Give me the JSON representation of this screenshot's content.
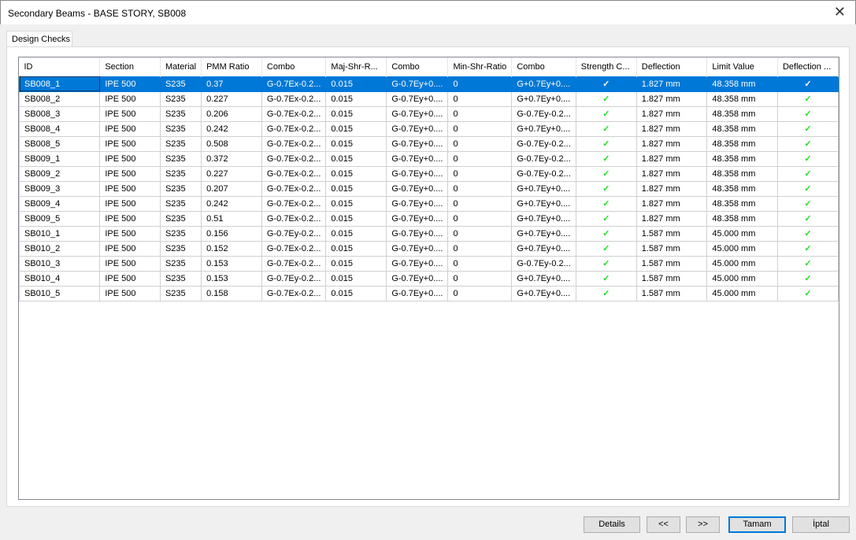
{
  "window": {
    "title": "Secondary Beams - BASE STORY, SB008",
    "close": "✕"
  },
  "tab": "Design Checks",
  "columns": [
    "ID",
    "Section",
    "Material",
    "PMM Ratio",
    "Combo",
    "Maj-Shr-R...",
    "Combo",
    "Min-Shr-Ratio",
    "Combo",
    "Strength C...",
    "Deflection",
    "Limit Value",
    "Deflection ..."
  ],
  "rows": [
    [
      "SB008_1",
      "IPE 500",
      "S235",
      "0.37",
      "G-0.7Ex-0.2...",
      "0.015",
      "G-0.7Ey+0....",
      "0",
      "G+0.7Ey+0....",
      "✓",
      "1.827 mm",
      "48.358 mm",
      "✓"
    ],
    [
      "SB008_2",
      "IPE 500",
      "S235",
      "0.227",
      "G-0.7Ex-0.2...",
      "0.015",
      "G-0.7Ey+0....",
      "0",
      "G+0.7Ey+0....",
      "✓",
      "1.827 mm",
      "48.358 mm",
      "✓"
    ],
    [
      "SB008_3",
      "IPE 500",
      "S235",
      "0.206",
      "G-0.7Ex-0.2...",
      "0.015",
      "G-0.7Ey+0....",
      "0",
      "G-0.7Ey-0.2...",
      "✓",
      "1.827 mm",
      "48.358 mm",
      "✓"
    ],
    [
      "SB008_4",
      "IPE 500",
      "S235",
      "0.242",
      "G-0.7Ex-0.2...",
      "0.015",
      "G-0.7Ey+0....",
      "0",
      "G+0.7Ey+0....",
      "✓",
      "1.827 mm",
      "48.358 mm",
      "✓"
    ],
    [
      "SB008_5",
      "IPE 500",
      "S235",
      "0.508",
      "G-0.7Ex-0.2...",
      "0.015",
      "G-0.7Ey+0....",
      "0",
      "G-0.7Ey-0.2...",
      "✓",
      "1.827 mm",
      "48.358 mm",
      "✓"
    ],
    [
      "SB009_1",
      "IPE 500",
      "S235",
      "0.372",
      "G-0.7Ex-0.2...",
      "0.015",
      "G-0.7Ey+0....",
      "0",
      "G-0.7Ey-0.2...",
      "✓",
      "1.827 mm",
      "48.358 mm",
      "✓"
    ],
    [
      "SB009_2",
      "IPE 500",
      "S235",
      "0.227",
      "G-0.7Ex-0.2...",
      "0.015",
      "G-0.7Ey+0....",
      "0",
      "G-0.7Ey-0.2...",
      "✓",
      "1.827 mm",
      "48.358 mm",
      "✓"
    ],
    [
      "SB009_3",
      "IPE 500",
      "S235",
      "0.207",
      "G-0.7Ex-0.2...",
      "0.015",
      "G-0.7Ey+0....",
      "0",
      "G+0.7Ey+0....",
      "✓",
      "1.827 mm",
      "48.358 mm",
      "✓"
    ],
    [
      "SB009_4",
      "IPE 500",
      "S235",
      "0.242",
      "G-0.7Ex-0.2...",
      "0.015",
      "G-0.7Ey+0....",
      "0",
      "G+0.7Ey+0....",
      "✓",
      "1.827 mm",
      "48.358 mm",
      "✓"
    ],
    [
      "SB009_5",
      "IPE 500",
      "S235",
      "0.51",
      "G-0.7Ex-0.2...",
      "0.015",
      "G-0.7Ey+0....",
      "0",
      "G+0.7Ey+0....",
      "✓",
      "1.827 mm",
      "48.358 mm",
      "✓"
    ],
    [
      "SB010_1",
      "IPE 500",
      "S235",
      "0.156",
      "G-0.7Ey-0.2...",
      "0.015",
      "G-0.7Ey+0....",
      "0",
      "G+0.7Ey+0....",
      "✓",
      "1.587 mm",
      "45.000 mm",
      "✓"
    ],
    [
      "SB010_2",
      "IPE 500",
      "S235",
      "0.152",
      "G-0.7Ex-0.2...",
      "0.015",
      "G-0.7Ey+0....",
      "0",
      "G+0.7Ey+0....",
      "✓",
      "1.587 mm",
      "45.000 mm",
      "✓"
    ],
    [
      "SB010_3",
      "IPE 500",
      "S235",
      "0.153",
      "G-0.7Ex-0.2...",
      "0.015",
      "G-0.7Ey+0....",
      "0",
      "G-0.7Ey-0.2...",
      "✓",
      "1.587 mm",
      "45.000 mm",
      "✓"
    ],
    [
      "SB010_4",
      "IPE 500",
      "S235",
      "0.153",
      "G-0.7Ey-0.2...",
      "0.015",
      "G-0.7Ey+0....",
      "0",
      "G+0.7Ey+0....",
      "✓",
      "1.587 mm",
      "45.000 mm",
      "✓"
    ],
    [
      "SB010_5",
      "IPE 500",
      "S235",
      "0.158",
      "G-0.7Ex-0.2...",
      "0.015",
      "G-0.7Ey+0....",
      "0",
      "G+0.7Ey+0....",
      "✓",
      "1.587 mm",
      "45.000 mm",
      "✓"
    ]
  ],
  "selected_row": 0,
  "buttons": {
    "details": "Details",
    "prev": "<<",
    "next": ">>",
    "ok": "Tamam",
    "cancel": "İptal"
  },
  "colors": {
    "selection": "#0078d7",
    "check": "#22dd22"
  }
}
